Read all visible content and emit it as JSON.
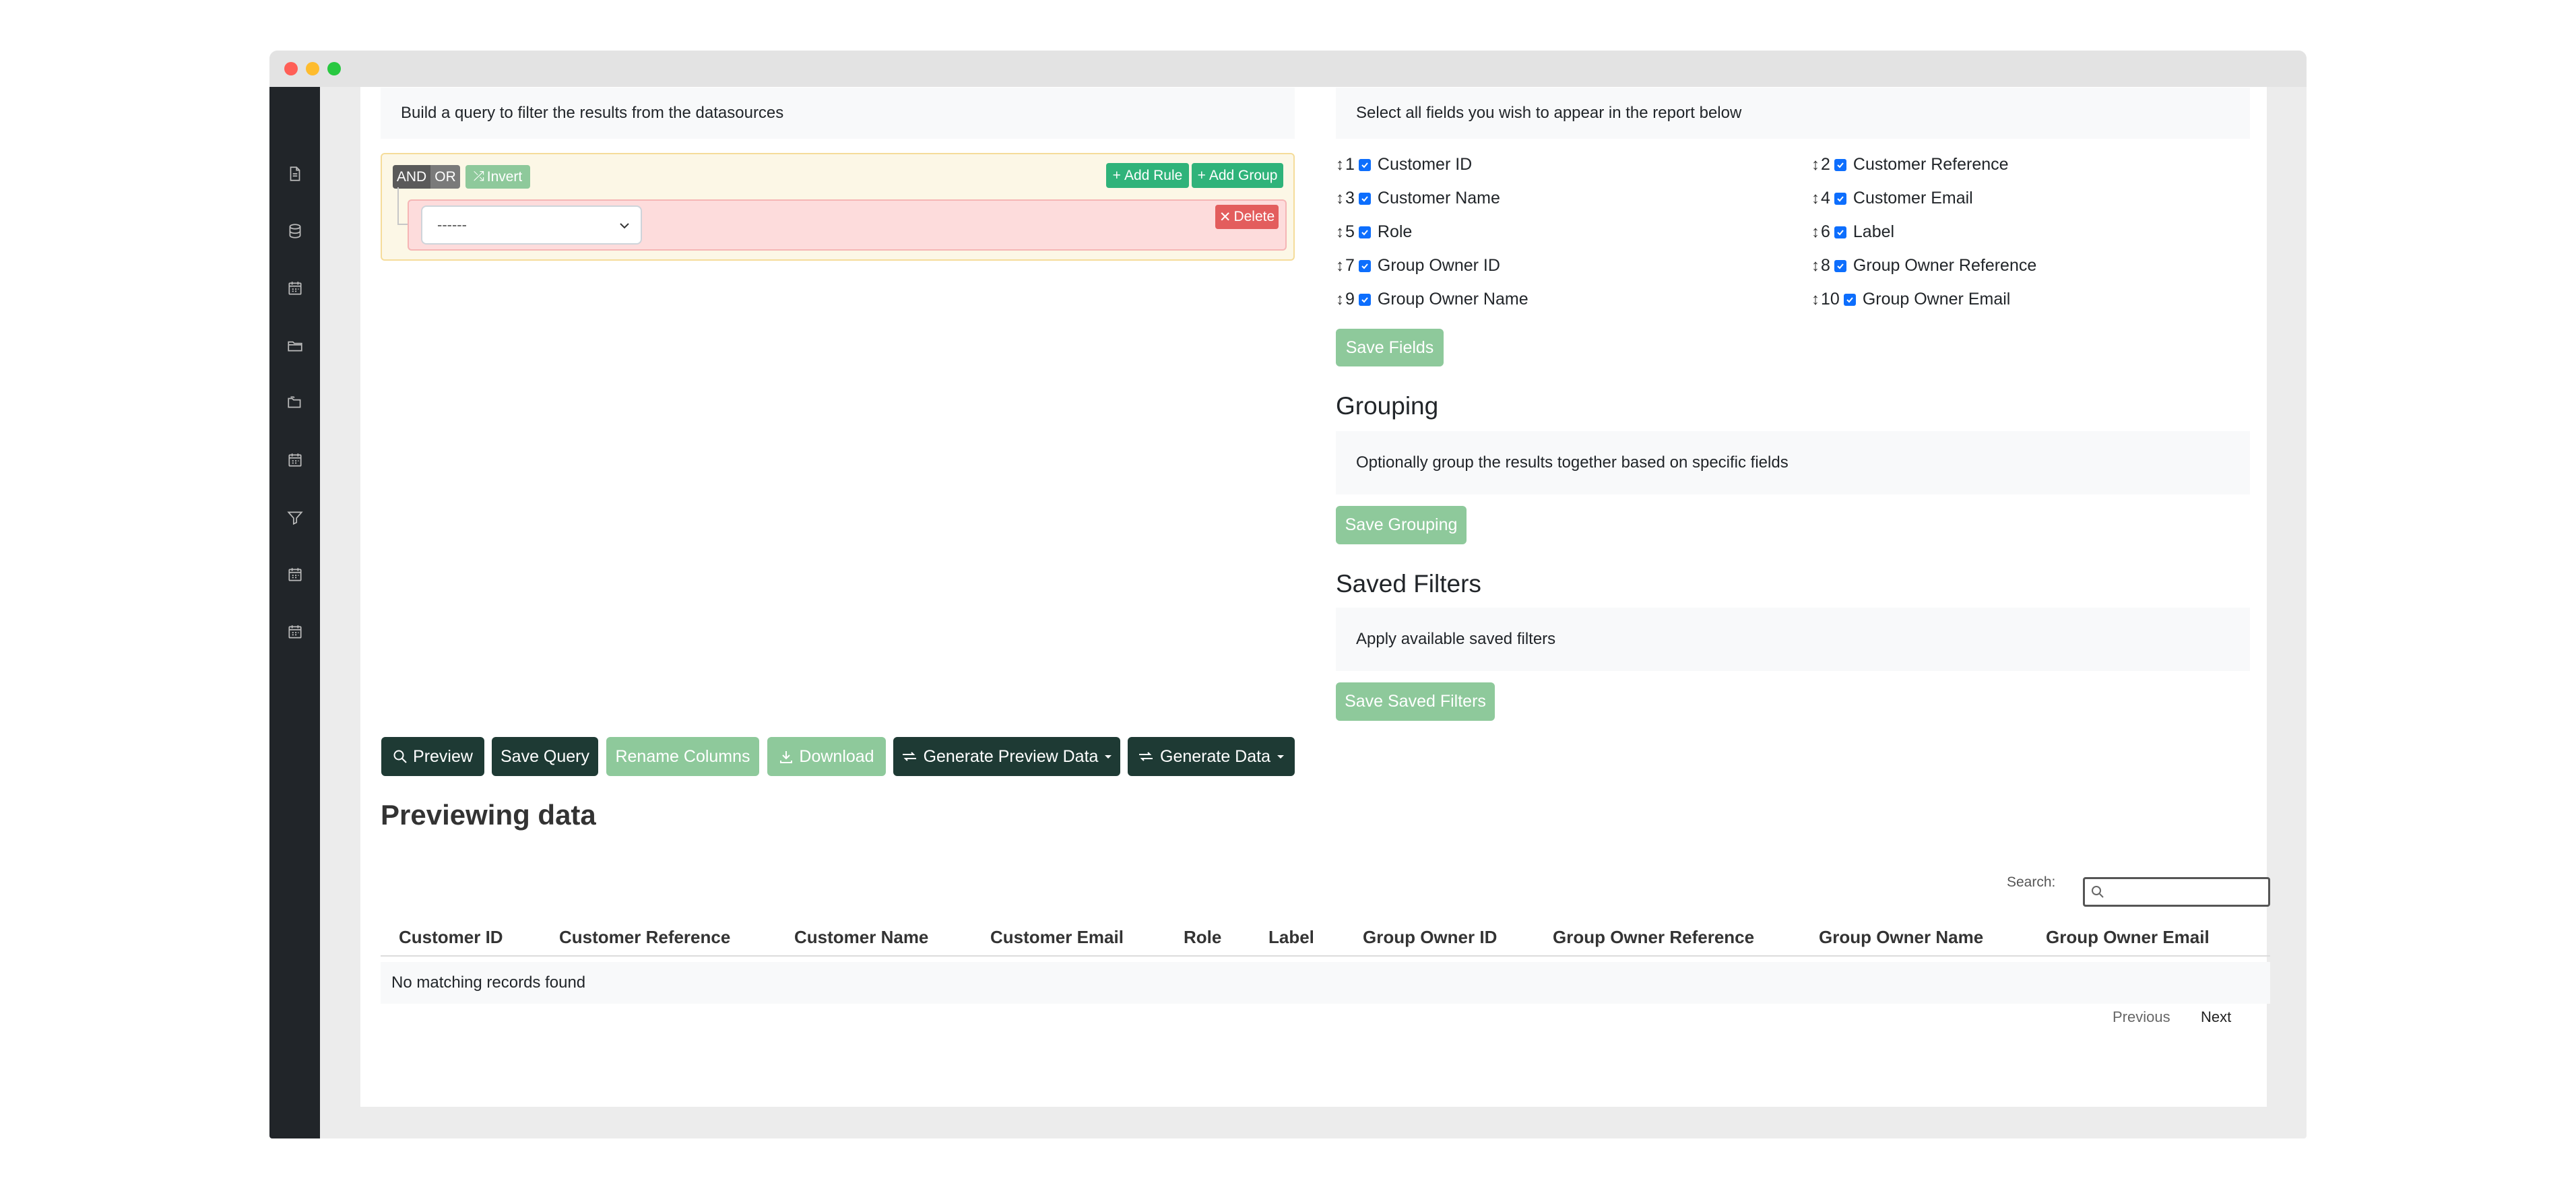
{
  "query_builder": {
    "intro": "Build a query to filter the results from the datasources",
    "and_label": "AND",
    "or_label": "OR",
    "invert_label": "Invert",
    "add_rule_label": "Add Rule",
    "add_group_label": "Add Group",
    "delete_label": "Delete",
    "select_value": "------"
  },
  "fields": {
    "intro": "Select all fields you wish to appear in the report below",
    "items": [
      {
        "num": "1",
        "label": "Customer ID"
      },
      {
        "num": "2",
        "label": "Customer Reference"
      },
      {
        "num": "3",
        "label": "Customer Name"
      },
      {
        "num": "4",
        "label": "Customer Email"
      },
      {
        "num": "5",
        "label": "Role"
      },
      {
        "num": "6",
        "label": "Label"
      },
      {
        "num": "7",
        "label": "Group Owner ID"
      },
      {
        "num": "8",
        "label": "Group Owner Reference"
      },
      {
        "num": "9",
        "label": "Group Owner Name"
      },
      {
        "num": "10",
        "label": "Group Owner Email"
      }
    ],
    "save_label": "Save Fields"
  },
  "grouping": {
    "title": "Grouping",
    "intro": "Optionally group the results together based on specific fields",
    "save_label": "Save Grouping"
  },
  "saved_filters": {
    "title": "Saved Filters",
    "intro": "Apply available saved filters",
    "save_label": "Save Saved Filters"
  },
  "actions": {
    "preview": "Preview",
    "save_query": "Save Query",
    "rename_columns": "Rename Columns",
    "download": "Download",
    "generate_preview_data": "Generate Preview Data",
    "generate_data": "Generate Data"
  },
  "preview": {
    "title": "Previewing data",
    "search_label": "Search:",
    "columns": [
      "Customer ID",
      "Customer Reference",
      "Customer Name",
      "Customer Email",
      "Role",
      "Label",
      "Group Owner ID",
      "Group Owner Reference",
      "Group Owner Name",
      "Group Owner Email"
    ],
    "empty_message": "No matching records found",
    "previous_label": "Previous",
    "next_label": "Next"
  },
  "sidebar_icons": [
    "file-icon",
    "database-icon",
    "calendar-icon",
    "folder-icon",
    "folders-icon",
    "calendar-icon",
    "filter-icon",
    "calendar-icon",
    "calendar-icon"
  ],
  "colors": {
    "sidebar": "#212529",
    "dark_button": "#1e3a34",
    "light_green_button": "#8ec99b",
    "add_button": "#2fb37a",
    "delete_button": "#e35d5d",
    "checkbox": "#0d6efd"
  }
}
